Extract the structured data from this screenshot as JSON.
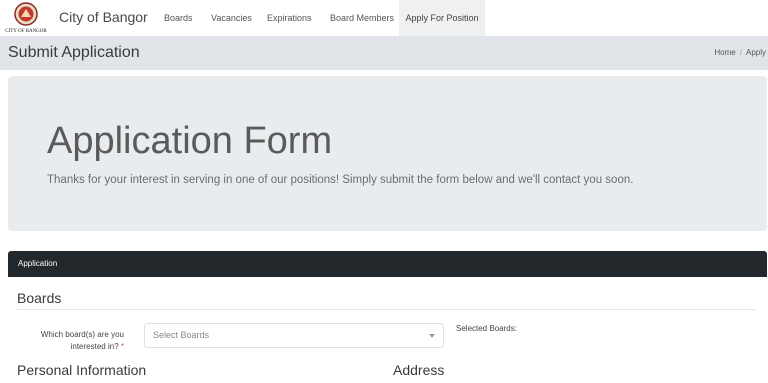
{
  "navbar": {
    "logo_text": "CITY OF BANGOR",
    "brand": "City of Bangor",
    "items": [
      {
        "label": "Boards"
      },
      {
        "label": "Vacancies"
      },
      {
        "label": "Expirations"
      },
      {
        "label": "Board Members"
      },
      {
        "label": "Apply For Position",
        "active": true
      }
    ]
  },
  "page_header": {
    "title": "Submit Application",
    "breadcrumb": [
      "Home",
      "Apply"
    ]
  },
  "hero": {
    "title": "Application Form",
    "lead": "Thanks for your interest in serving in one of our positions! Simply submit the form below and we'll contact you soon."
  },
  "card": {
    "header": "Application",
    "boards_section": "Boards",
    "question_label": "Which board(s) are you interested in?",
    "required_mark": "*",
    "select_placeholder": "Select Boards",
    "selected_label": "Selected Boards:",
    "personal_section": "Personal Information",
    "address_section": "Address"
  },
  "colors": {
    "card_header_bg": "#23282d",
    "page_bar_bg": "#e1e5ea",
    "hero_bg": "#e9ecef",
    "required": "#d9534f"
  }
}
